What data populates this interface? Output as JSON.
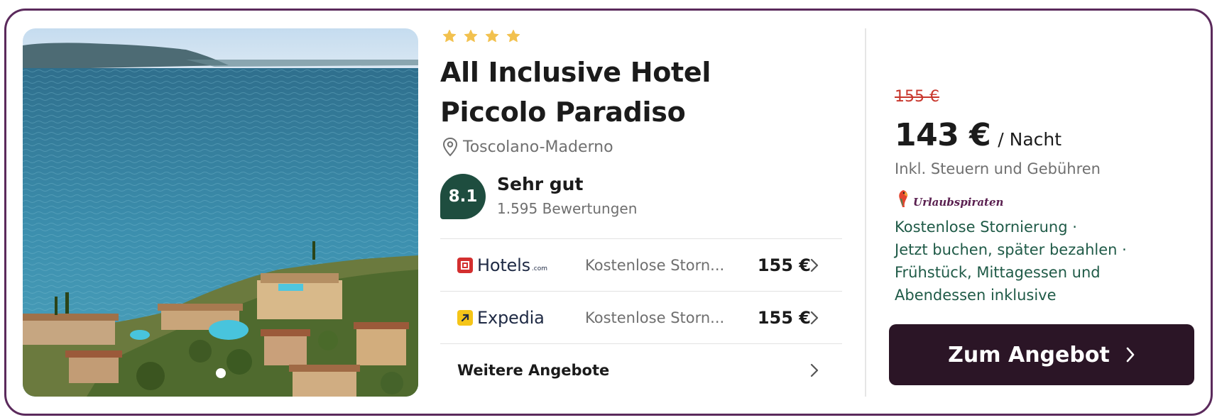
{
  "hotel": {
    "stars": 4,
    "name": "All Inclusive Hotel Piccolo Paradiso",
    "location": "Toscolano-Maderno",
    "rating": {
      "score": "8.1",
      "label": "Sehr gut",
      "count": "1.595 Bewertungen"
    }
  },
  "gallery": {
    "image_count_dots": 1,
    "active_dot": 0
  },
  "offers": [
    {
      "provider": "Hotels",
      "provider_suffix": ".com",
      "logo_color": "#d32f2f",
      "description": "Kostenlose Storn...",
      "price": "155 €"
    },
    {
      "provider": "Expedia",
      "provider_suffix": "",
      "logo_color": "#f5c518",
      "description": "Kostenlose Storn...",
      "price": "155 €"
    }
  ],
  "more_offers": {
    "label": "Weitere Angebote"
  },
  "deal": {
    "old_price": "155 €",
    "price": "143 €",
    "per_night": "/ Nacht",
    "tax_note": "Inkl. Steuern und Gebühren",
    "provider": "Urlaubspiraten",
    "features": [
      "Kostenlose Stornierung ·",
      "Jetzt buchen, später bezahlen ·",
      "Frühstück, Mittagessen und",
      "Abendessen inklusive"
    ],
    "cta_label": "Zum Angebot"
  },
  "colors": {
    "border": "#5b2a5c",
    "rating_badge": "#1e4d3f",
    "star": "#f2c14e",
    "old_price": "#c8372d",
    "feature_text": "#1f5a47",
    "cta_bg": "#2b1526"
  },
  "icons": {
    "star": "star-icon",
    "location": "location-pin-icon",
    "chevron": "chevron-right-icon",
    "provider_logo": "parrot-logo-icon"
  }
}
